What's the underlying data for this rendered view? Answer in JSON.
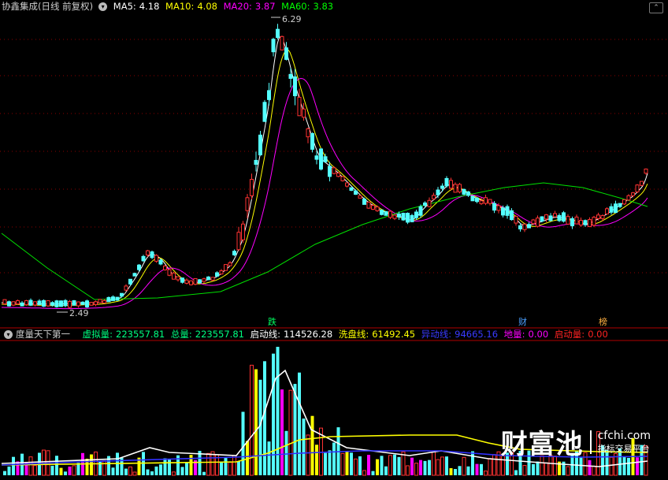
{
  "main_header": {
    "title": "协鑫集成(日线 前复权)",
    "ma5": {
      "label": "MA5:",
      "value": "4.18",
      "color": "#ffffff"
    },
    "ma10": {
      "label": "MA10:",
      "value": "4.08",
      "color": "#ffff00"
    },
    "ma20": {
      "label": "MA20:",
      "value": "3.87",
      "color": "#ff00ff"
    },
    "ma60": {
      "label": "MA60:",
      "value": "3.83",
      "color": "#00ff00"
    }
  },
  "sub_header": {
    "title": "度量天下第一",
    "items": [
      {
        "label": "虚拟量:",
        "value": "223557.81",
        "color": "#00ff80"
      },
      {
        "label": "总量:",
        "value": "223557.81",
        "color": "#00ff80"
      },
      {
        "label": "启动线:",
        "value": "114526.28",
        "color": "#ffffff"
      },
      {
        "label": "洗盘线:",
        "value": "61492.45",
        "color": "#ffff00"
      },
      {
        "label": "异动线:",
        "value": "94665.16",
        "color": "#3030ff"
      },
      {
        "label": "地量:",
        "value": "0.00",
        "color": "#ff00ff"
      },
      {
        "label": "启动量:",
        "value": "0.00",
        "color": "#ff2020"
      }
    ]
  },
  "markers": {
    "high_label": "6.29",
    "low_label": "2.49",
    "tag_die": "跌",
    "tag_cai": "财",
    "tag_bang": "榜"
  },
  "watermark": {
    "brand": "财富池",
    "site": "cfchi.com",
    "slogan": "指标交易平台"
  },
  "colors": {
    "up_candle": "#ff3232",
    "down_candle": "#54ffff",
    "grid": "#8b0000",
    "divider": "#b00000"
  },
  "chart_data": [
    {
      "type": "candlestick",
      "price_range": [
        2.2,
        6.6
      ],
      "high": 6.29,
      "low": 2.49,
      "series": [
        {
          "name": "MA5",
          "value": 4.18
        },
        {
          "name": "MA10",
          "value": 4.08
        },
        {
          "name": "MA20",
          "value": 3.87
        },
        {
          "name": "MA60",
          "value": 3.83
        }
      ]
    },
    {
      "type": "bar",
      "title": "度量天下第一",
      "series": [
        {
          "name": "虚拟量",
          "value": 223557.81
        },
        {
          "name": "总量",
          "value": 223557.81
        },
        {
          "name": "启动线",
          "value": 114526.28
        },
        {
          "name": "洗盘线",
          "value": 61492.45
        },
        {
          "name": "异动线",
          "value": 94665.16
        },
        {
          "name": "地量",
          "value": 0.0
        },
        {
          "name": "启动量",
          "value": 0.0
        }
      ]
    }
  ]
}
